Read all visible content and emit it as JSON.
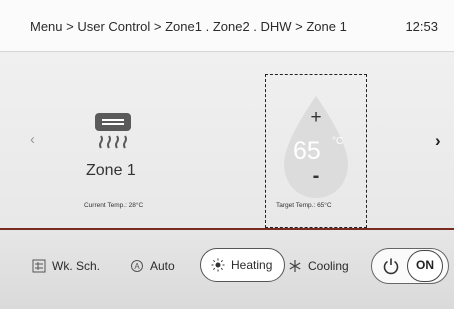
{
  "header": {
    "breadcrumb": "Menu > User Control > Zone1 . Zone2 . DHW > Zone 1",
    "time": "12:53"
  },
  "nav": {
    "prev": "‹",
    "next": "›"
  },
  "zone": {
    "name": "Zone 1",
    "current_temp_label": "Current Temp.: 28°C",
    "icon": "radiator-icon"
  },
  "target": {
    "plus": "+",
    "minus": "-",
    "value": "65",
    "unit": "°C",
    "label": "Target Temp.: 65°C",
    "icon": "water-drop-icon"
  },
  "modes": {
    "weekly_schedule": "Wk. Sch.",
    "auto": "Auto",
    "heating": "Heating",
    "cooling": "Cooling",
    "selected": "Heating"
  },
  "power": {
    "on_label": "ON",
    "icon": "power-icon"
  },
  "colors": {
    "divider": "#7a2b1f",
    "drop": "#dcdcdc",
    "background": "#ececec"
  }
}
